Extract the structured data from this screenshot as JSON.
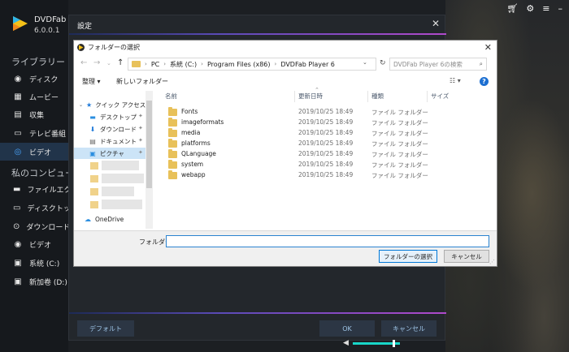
{
  "app": {
    "name": "DVDFab Pla",
    "version": "6.0.0.1",
    "library_label": "ライブラリー",
    "my_computer_label": "私のコンピュータ",
    "nav": [
      {
        "label": "ディスク",
        "icon": "disc-icon"
      },
      {
        "label": "ムービー",
        "icon": "movie-icon"
      },
      {
        "label": "収集",
        "icon": "collection-icon"
      },
      {
        "label": "テレビ番組",
        "icon": "tv-icon"
      },
      {
        "label": "ビデオ",
        "icon": "video-icon"
      }
    ],
    "computer_nav": [
      {
        "label": "ファイルエクスプ",
        "icon": "file-explorer-icon"
      },
      {
        "label": "ディスクトップ",
        "icon": "desktop-icon"
      },
      {
        "label": "ダウンロード",
        "icon": "download-icon"
      },
      {
        "label": "ビデオ",
        "icon": "video-icon"
      },
      {
        "label": "系统 (C:)",
        "icon": "drive-icon"
      },
      {
        "label": "新加卷 (D:)",
        "icon": "drive-icon"
      }
    ],
    "accent_color": "#4aa6ff",
    "volume_level": 0.87
  },
  "settings": {
    "title": "設定",
    "default_button": "デフォルト",
    "ok_button": "OK",
    "cancel_button": "キャンセル"
  },
  "picker": {
    "title": "フォルダーの選択",
    "breadcrumb": [
      "PC",
      "系統 (C:)",
      "Program Files (x86)",
      "DVDFab Player 6"
    ],
    "search_placeholder": "DVDFab Player 6の検索",
    "toolbar": {
      "organize": "整理",
      "new_folder": "新しいフォルダー"
    },
    "tree": [
      {
        "label": "クイック アクセス",
        "icon": "star-icon"
      },
      {
        "label": "デスクトップ",
        "icon": "desktop-icon"
      },
      {
        "label": "ダウンロード",
        "icon": "download-icon"
      },
      {
        "label": "ドキュメント",
        "icon": "document-icon"
      },
      {
        "label": "ピクチャ",
        "icon": "pictures-icon"
      },
      {
        "label": "OneDrive",
        "icon": "cloud-icon"
      }
    ],
    "columns": {
      "name": "名前",
      "date": "更新日時",
      "type": "種類",
      "size": "サイズ"
    },
    "rows": [
      {
        "name": "Fonts",
        "date": "2019/10/25 18:49",
        "type": "ファイル フォルダー"
      },
      {
        "name": "imageformats",
        "date": "2019/10/25 18:49",
        "type": "ファイル フォルダー"
      },
      {
        "name": "media",
        "date": "2019/10/25 18:49",
        "type": "ファイル フォルダー"
      },
      {
        "name": "platforms",
        "date": "2019/10/25 18:49",
        "type": "ファイル フォルダー"
      },
      {
        "name": "QLanguage",
        "date": "2019/10/25 18:49",
        "type": "ファイル フォルダー"
      },
      {
        "name": "system",
        "date": "2019/10/25 18:49",
        "type": "ファイル フォルダー"
      },
      {
        "name": "webapp",
        "date": "2019/10/25 18:49",
        "type": "ファイル フォルダー"
      }
    ],
    "folder_label": "フォルダー:",
    "folder_value": "",
    "select_button": "フォルダーの選択",
    "cancel_button": "キャンセル"
  }
}
